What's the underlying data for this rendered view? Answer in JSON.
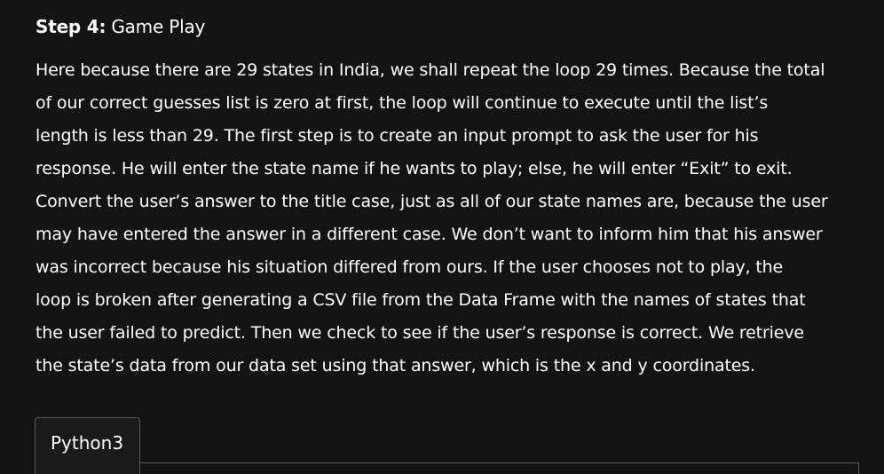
{
  "heading": {
    "step_label": "Step 4:",
    "title": "Game Play"
  },
  "paragraph_lines": [
    "Here because there are 29 states in India, we shall repeat the loop 29 times. Because the total",
    "of our correct guesses list is zero at first, the loop will continue to execute until the list’s",
    "length is less than 29. The first step is to create an input prompt to ask the user for his",
    "response. He will enter the state name if he wants to play; else, he will enter “Exit” to exit.",
    "Convert the user’s answer to the title case, just as all of our state names are, because the user",
    "may have entered the answer in a different case. We don’t want to inform him that his answer",
    "was incorrect because his situation differed from ours. If the user chooses not to play, the",
    "loop is broken after generating a CSV file from the Data Frame with the names of states that",
    "the user failed to predict. Then we check to see if the user’s response is correct. We retrieve",
    "the state’s data from our data set using that answer, which is the x and y coordinates."
  ],
  "code_tabs": [
    {
      "label": "Python3",
      "selected": true
    }
  ]
}
